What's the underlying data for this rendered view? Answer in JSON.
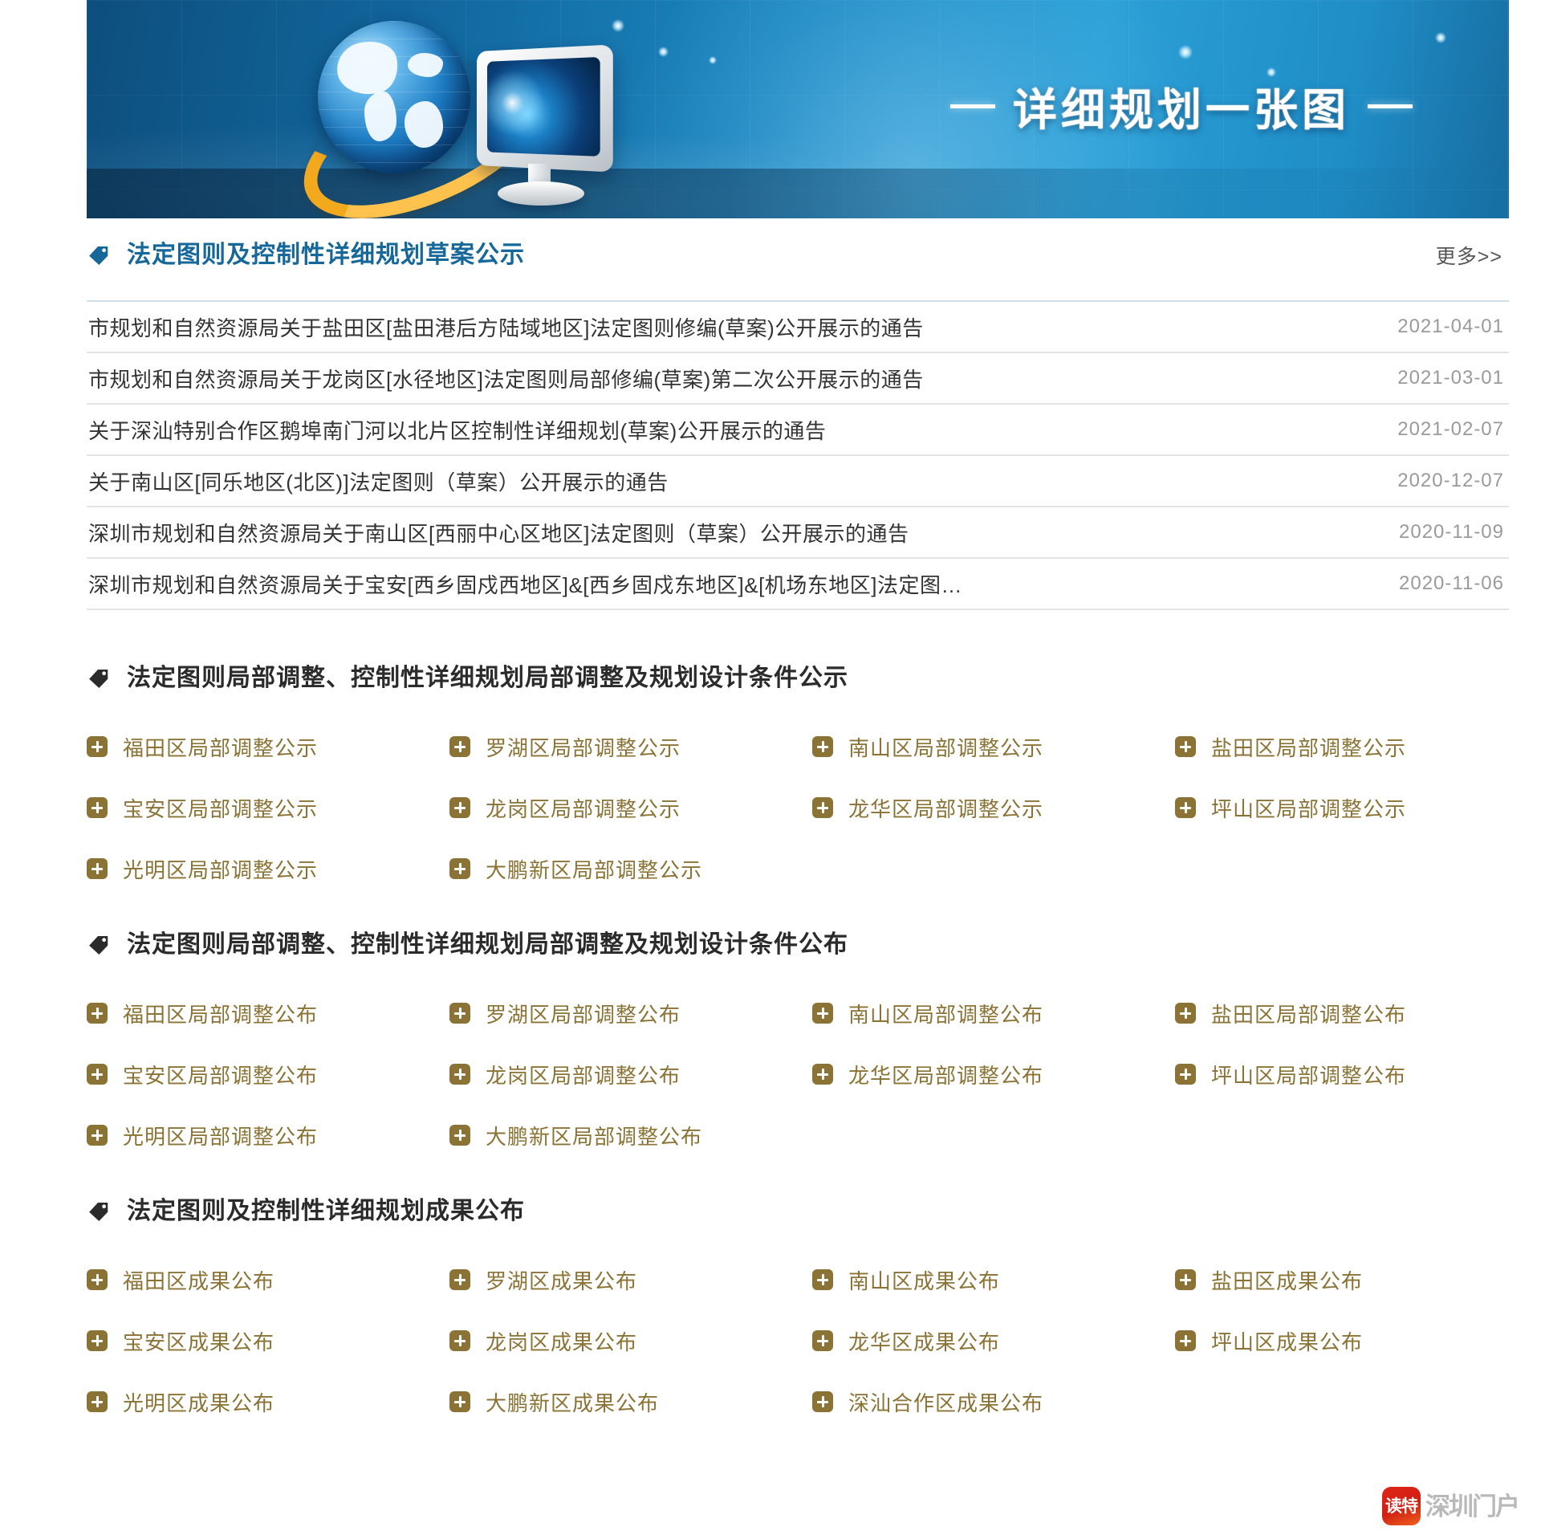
{
  "banner": {
    "title": "详细规划一张图",
    "icons": {
      "globe": "globe-icon",
      "monitor": "monitor-icon"
    }
  },
  "sections": [
    {
      "id": "draft-publicity",
      "icon": "tag-icon",
      "title": "法定图则及控制性详细规划草案公示",
      "more_label": "更多>>",
      "news": [
        {
          "title": "市规划和自然资源局关于盐田区[盐田港后方陆域地区]法定图则修编(草案)公开展示的通告",
          "date": "2021-04-01"
        },
        {
          "title": "市规划和自然资源局关于龙岗区[水径地区]法定图则局部修编(草案)第二次公开展示的通告",
          "date": "2021-03-01"
        },
        {
          "title": "关于深汕特别合作区鹅埠南门河以北片区控制性详细规划(草案)公开展示的通告",
          "date": "2021-02-07"
        },
        {
          "title": "关于南山区[同乐地区(北区)]法定图则（草案）公开展示的通告",
          "date": "2020-12-07"
        },
        {
          "title": "深圳市规划和自然资源局关于南山区[西丽中心区地区]法定图则（草案）公开展示的通告",
          "date": "2020-11-09"
        },
        {
          "title": "深圳市规划和自然资源局关于宝安[西乡固戍西地区]&[西乡固戍东地区]&[机场东地区]法定图…",
          "date": "2020-11-06"
        }
      ]
    },
    {
      "id": "partial-adjustment-publicity",
      "icon": "tag-icon",
      "title": "法定图则局部调整、控制性详细规划局部调整及规划设计条件公示",
      "links": [
        "福田区局部调整公示",
        "罗湖区局部调整公示",
        "南山区局部调整公示",
        "盐田区局部调整公示",
        "宝安区局部调整公示",
        "龙岗区局部调整公示",
        "龙华区局部调整公示",
        "坪山区局部调整公示",
        "光明区局部调整公示",
        "大鹏新区局部调整公示"
      ]
    },
    {
      "id": "partial-adjustment-announcement",
      "icon": "tag-icon",
      "title": "法定图则局部调整、控制性详细规划局部调整及规划设计条件公布",
      "links": [
        "福田区局部调整公布",
        "罗湖区局部调整公布",
        "南山区局部调整公布",
        "盐田区局部调整公布",
        "宝安区局部调整公布",
        "龙岗区局部调整公布",
        "龙华区局部调整公布",
        "坪山区局部调整公布",
        "光明区局部调整公布",
        "大鹏新区局部调整公布"
      ]
    },
    {
      "id": "results-announcement",
      "icon": "tag-icon",
      "title": "法定图则及控制性详细规划成果公布",
      "links": [
        "福田区成果公布",
        "罗湖区成果公布",
        "南山区成果公布",
        "盐田区成果公布",
        "宝安区成果公布",
        "龙岗区成果公布",
        "龙华区成果公布",
        "坪山区成果公布",
        "光明区成果公布",
        "大鹏新区成果公布",
        "深汕合作区成果公布"
      ]
    }
  ],
  "watermark": {
    "badge_text": "读特",
    "text": "深圳门户"
  },
  "colors": {
    "accent_blue": "#16679a",
    "link_gold": "#8a7334",
    "date_gray": "#9a9a9a",
    "watermark_red": "#d61f12"
  }
}
